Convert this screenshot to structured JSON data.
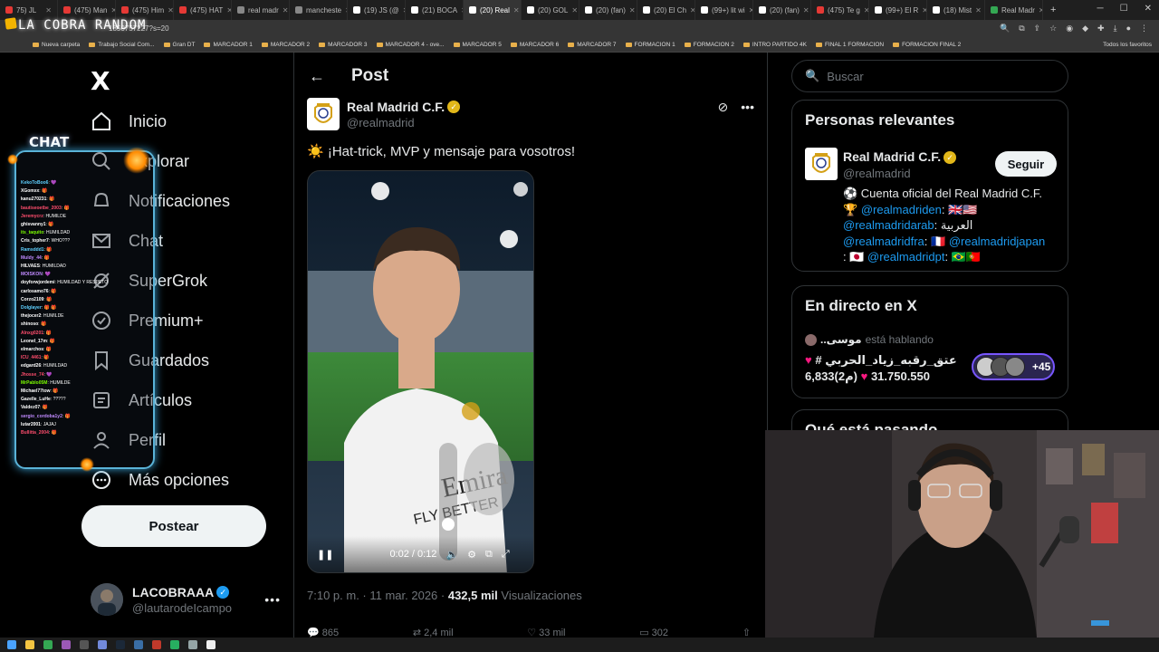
{
  "browser": {
    "tabs": [
      {
        "label": "75) JL",
        "color": "#e53935"
      },
      {
        "label": "(475) Man",
        "color": "#e53935"
      },
      {
        "label": "(475) Him",
        "color": "#e53935"
      },
      {
        "label": "(475) HAT",
        "color": "#e53935"
      },
      {
        "label": "real madr",
        "color": "#888888"
      },
      {
        "label": "mancheste",
        "color": "#888888"
      },
      {
        "label": "(19) JS (@",
        "color": "#ffffff"
      },
      {
        "label": "(21) BOCA",
        "color": "#ffffff"
      },
      {
        "label": "(20) Real",
        "color": "#ffffff",
        "active": true
      },
      {
        "label": "(20) GOL",
        "color": "#ffffff"
      },
      {
        "label": "(20) (fan)",
        "color": "#ffffff"
      },
      {
        "label": "(20) El Ch",
        "color": "#ffffff"
      },
      {
        "label": "(99+) lit wi",
        "color": "#ffffff"
      },
      {
        "label": "(20) (fan)",
        "color": "#ffffff"
      },
      {
        "label": "(475) Te g",
        "color": "#e53935"
      },
      {
        "label": "(99+) El R",
        "color": "#ffffff"
      },
      {
        "label": "(18) Mist",
        "color": "#ffffff"
      },
      {
        "label": "Real Madr",
        "color": "#34a853"
      }
    ],
    "url": "1850757227?s=20",
    "bookmarks": [
      "Nueva carpeta",
      "Trabajo Social Com...",
      "Gran DT",
      "MARCADOR 1",
      "MARCADOR 2",
      "MARCADOR 3",
      "MARCADOR 4 - ove...",
      "MARCADOR 5",
      "MARCADOR 6",
      "MARCADOR 7",
      "FORMACION 1",
      "FORMACION 2",
      "INTRO PARTIDO 4K",
      "FINAL 1 FORMACION",
      "FORMACION FINAL 2"
    ],
    "bookmarks_right": "Todos los favoritos"
  },
  "overlay": {
    "brand": "LA COBRA RANDOM",
    "chat_title": "CHAT",
    "chat_lines": [
      {
        "user": "KekoToBoo6",
        "msg": ": 💜",
        "color": "#5fd0ff"
      },
      {
        "user": "XGomxx",
        "msg": ": 🎁",
        "color": "#ffffff"
      },
      {
        "user": "kanu270231",
        "msg": ": 🎁",
        "color": "#ffffff"
      },
      {
        "user": "bautiseoetbe_2003",
        "msg": ": 🎁",
        "color": "#ff4d6d"
      },
      {
        "user": "Jeremycrz",
        "msg": ": HUMILDE",
        "color": "#ff4d6d"
      },
      {
        "user": "ghisvanny1",
        "msg": ": 🎁",
        "color": "#ffffff"
      },
      {
        "user": "its_taquito",
        "msg": ": HUMILDAD",
        "color": "#7CFC00"
      },
      {
        "user": "Cris_topher7",
        "msg": ": WHO???",
        "color": "#ffffff"
      },
      {
        "user": "Ramsddd1",
        "msg": ": 🎁",
        "color": "#5fd0ff"
      },
      {
        "user": "Muldy_44",
        "msg": ": 🎁",
        "color": "#c08aff"
      },
      {
        "user": "HILVAES",
        "msg": ": HUMILDAD",
        "color": "#ffffff"
      },
      {
        "user": "MOISKON",
        "msg": ": 💜",
        "color": "#c08aff"
      },
      {
        "user": "doyforwjordemi",
        "msg": ": HUMILDAD Y RESPETO",
        "color": "#ffffff"
      },
      {
        "user": "carlosamo76",
        "msg": ": 🎁",
        "color": "#ffffff"
      },
      {
        "user": "Corzo2109",
        "msg": ": 🎁",
        "color": "#ffffff"
      },
      {
        "user": "Dolglayer",
        "msg": ": 🎁 🎁",
        "color": "#5fd0ff"
      },
      {
        "user": "thejocer2",
        "msg": ": HUMILDE",
        "color": "#ffffff"
      },
      {
        "user": "shinoso",
        "msg": ": 🎁",
        "color": "#ffffff"
      },
      {
        "user": "Alnxg0201",
        "msg": ": 🎁",
        "color": "#ff4d6d"
      },
      {
        "user": "Leonel_17m",
        "msg": ": 🎁",
        "color": "#ffffff"
      },
      {
        "user": "elmarchos",
        "msg": ": 🎁",
        "color": "#ffffff"
      },
      {
        "user": "ICU_4461",
        "msg": ": 🎁",
        "color": "#ff4d6d"
      },
      {
        "user": "edgard26",
        "msg": ": HUMILDAD",
        "color": "#ffffff"
      },
      {
        "user": "Jhosse_74",
        "msg": ": 💜",
        "color": "#ff4d6d"
      },
      {
        "user": "MrPablo05M",
        "msg": ": HUMILDE",
        "color": "#7CFC00"
      },
      {
        "user": "Michael77tow",
        "msg": ": 🎁",
        "color": "#ffffff"
      },
      {
        "user": "Gazelle_LuHe",
        "msg": ": ?????",
        "color": "#ffffff"
      },
      {
        "user": "Valdez07",
        "msg": ": 🎁",
        "color": "#ffffff"
      },
      {
        "user": "sergio_cordoba1y2",
        "msg": ": 🎁",
        "color": "#c08aff"
      },
      {
        "user": "lutar2001",
        "msg": ": JAJAJ",
        "color": "#ffffff"
      },
      {
        "user": "Bullitta_2004",
        "msg": ": 🎁",
        "color": "#ff4d6d"
      }
    ]
  },
  "leftnav": {
    "logo": "X",
    "items": [
      {
        "label": "Inicio",
        "icon": "home-icon"
      },
      {
        "label": "Explorar",
        "icon": "search-icon"
      },
      {
        "label": "Notificaciones",
        "icon": "bell-icon"
      },
      {
        "label": "Chat",
        "icon": "mail-icon"
      },
      {
        "label": "SuperGrok",
        "icon": "grok-icon"
      },
      {
        "label": "Premium+",
        "icon": "premium-icon"
      },
      {
        "label": "Guardados",
        "icon": "bookmark-icon"
      },
      {
        "label": "Artículos",
        "icon": "article-icon"
      },
      {
        "label": "Perfil",
        "icon": "person-icon"
      },
      {
        "label": "Más opciones",
        "icon": "more-circle-icon"
      }
    ],
    "post_button": "Postear",
    "profile": {
      "name": "LACOBRAAA",
      "handle": "@lautarodeIcampo",
      "more": "•••"
    }
  },
  "main": {
    "title": "Post",
    "author": {
      "name": "Real Madrid C.F.",
      "handle": "@realmadrid"
    },
    "text": "☀️ ¡Hat-trick, MVP y mensaje para vosotros!",
    "video": {
      "time": "0:02 / 0:12",
      "progress": 0.17
    },
    "meta": {
      "time": "7:10 p. m. · 11 mar. 2026 · ",
      "views": "432,5 mil",
      "views_label": " Visualizaciones"
    },
    "actions": [
      "865",
      "2,4 mil",
      "33 mil",
      "302"
    ]
  },
  "right": {
    "search_placeholder": "Buscar",
    "relevant": {
      "title": "Personas relevantes",
      "name": "Real Madrid C.F.",
      "handle": "@realmadrid",
      "follow": "Seguir",
      "bio_1": "⚽ Cuenta oficial del Real Madrid C.F.",
      "bio_2_prefix": "🏆 ",
      "bio_2_mention": "@realmadriden",
      "bio_2_suffix": ": 🇬🇧🇺🇸",
      "bio_3_mention": "@realmadridarab",
      "bio_3_suffix": ": العربية",
      "bio_4_mention": "@realmadridfra",
      "bio_4_mid": ": 🇫🇷 ",
      "bio_4_mention2": "@realmadridjapan",
      "bio_5_prefix": ": 🇯🇵 ",
      "bio_5_mention": "@realmadridpt",
      "bio_5_suffix": ": 🇧🇷🇵🇹"
    },
    "live": {
      "title": "En directo en X",
      "host": "..موسى",
      "host_suffix": " está hablando",
      "space_title": "# عتق_رقبه_زياد_الحربي",
      "stat1": "6,833(2م)",
      "stat2": "31.750.550",
      "listeners": "+45"
    },
    "happening_title": "Qué está pasando"
  }
}
